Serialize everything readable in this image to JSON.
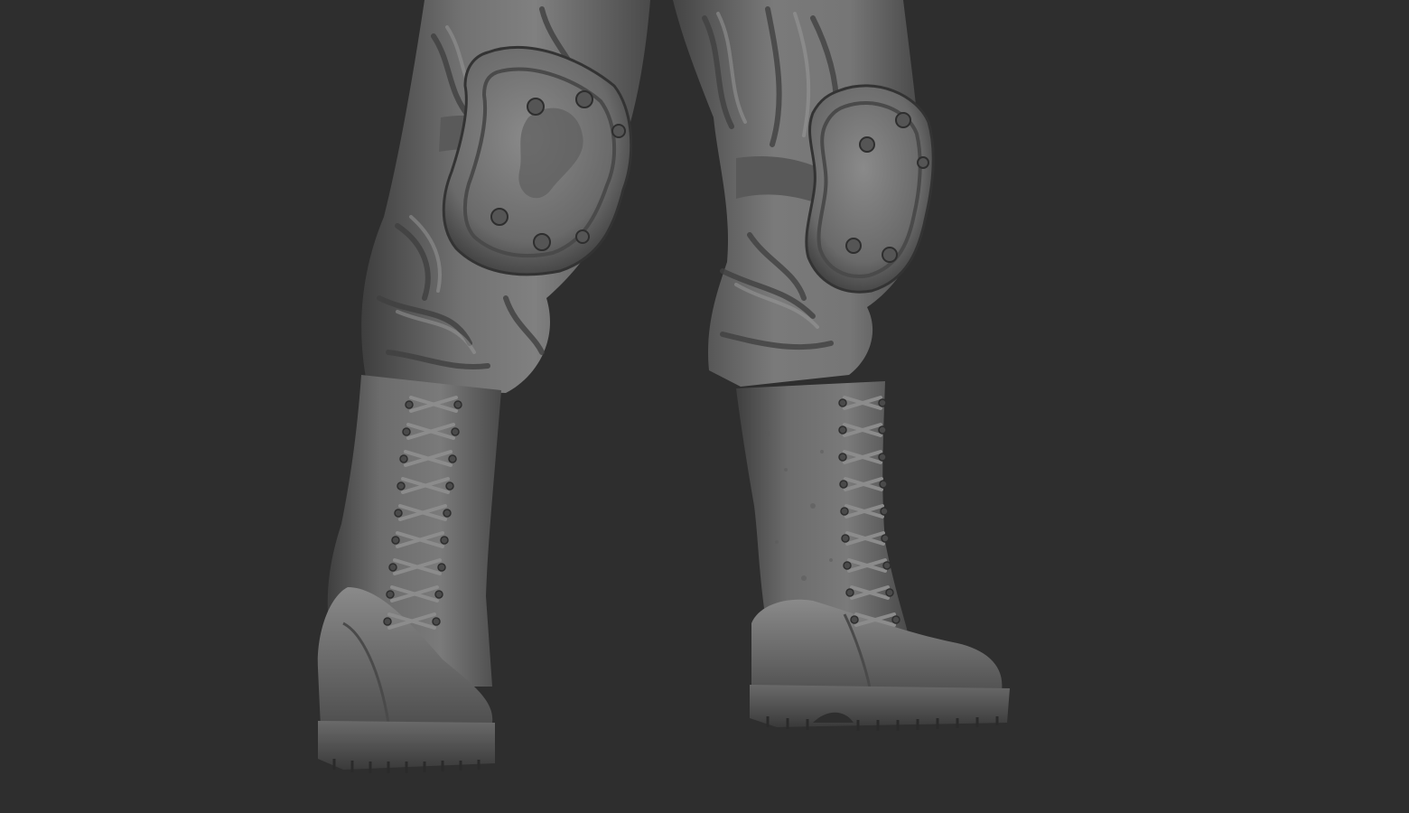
{
  "scene": {
    "background_color": "#2e2e2e",
    "material_base": "#6e6e6e",
    "material_light": "#9a9a9a",
    "material_dark": "#3a3a3a",
    "subject": "sculpted-legs-with-knee-pads-and-combat-boots"
  }
}
